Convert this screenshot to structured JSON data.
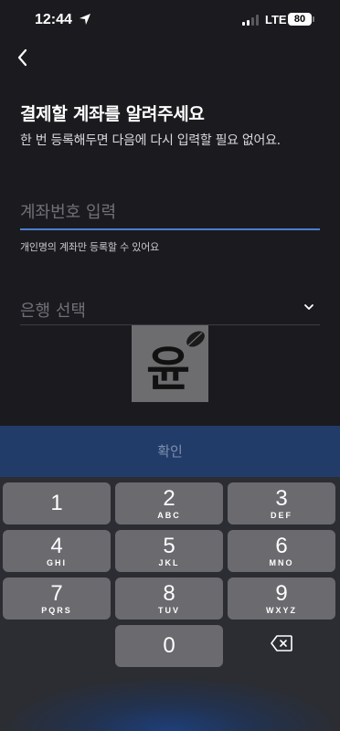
{
  "status_bar": {
    "time": "12:44",
    "network": "LTE",
    "battery": "80"
  },
  "header": {
    "back_icon": "chevron-left-icon"
  },
  "title": "결제할 계좌를 알려주세요",
  "subtitle": "한 번 등록해두면 다음에 다시 입력할 필요 없어요.",
  "account_field": {
    "placeholder": "계좌번호 입력",
    "helper": "개인명의 계좌만 등록할 수 있어요"
  },
  "bank_field": {
    "placeholder": "은행 선택"
  },
  "watermark_text": "윤",
  "confirm_label": "확인",
  "keypad": {
    "keys": [
      {
        "digit": "1",
        "letters": ""
      },
      {
        "digit": "2",
        "letters": "ABC"
      },
      {
        "digit": "3",
        "letters": "DEF"
      },
      {
        "digit": "4",
        "letters": "GHI"
      },
      {
        "digit": "5",
        "letters": "JKL"
      },
      {
        "digit": "6",
        "letters": "MNO"
      },
      {
        "digit": "7",
        "letters": "PQRS"
      },
      {
        "digit": "8",
        "letters": "TUV"
      },
      {
        "digit": "9",
        "letters": "WXYZ"
      },
      {
        "digit": "0",
        "letters": ""
      }
    ]
  },
  "colors": {
    "background": "#1b1b1f",
    "accent": "#4a7fd0",
    "confirm_bg": "#223c6a",
    "key_bg": "#6a6a6f"
  }
}
